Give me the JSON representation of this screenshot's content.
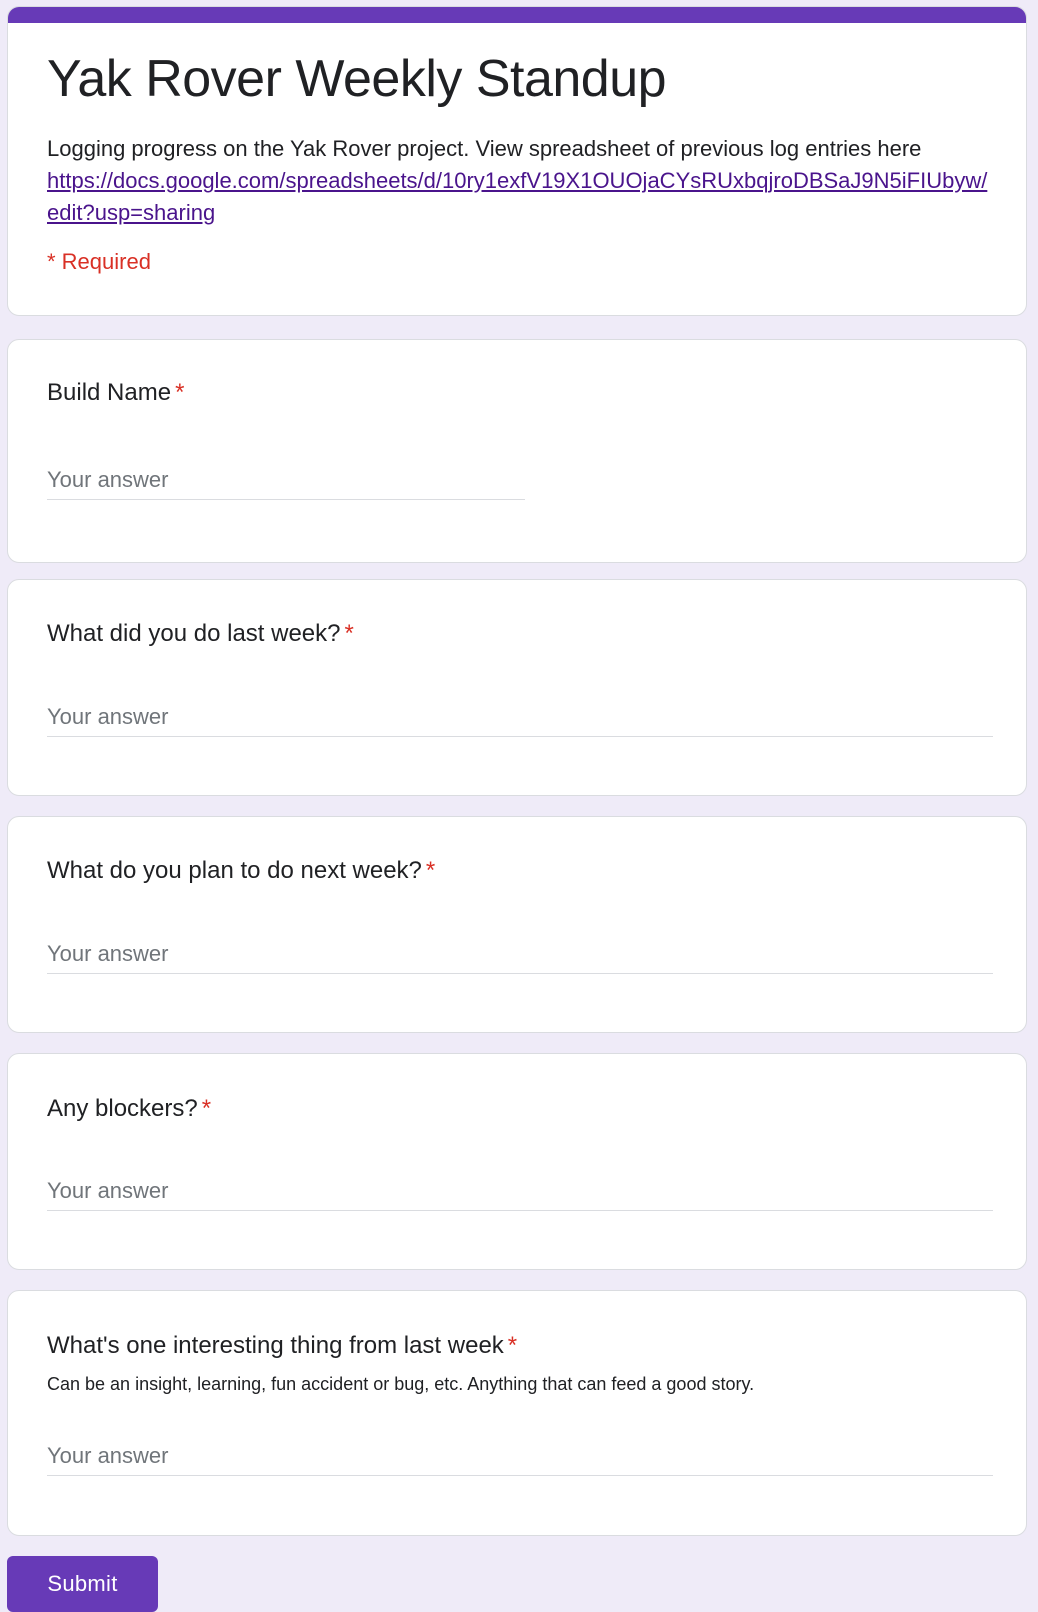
{
  "form": {
    "title": "Yak Rover Weekly Standup",
    "description": "Logging progress on the Yak Rover project. View spreadsheet of previous log entries here",
    "link": "https://docs.google.com/spreadsheets/d/10ry1exfV19X1OUOjaCYsRUxbqjroDBSaJ9N5iFIUbyw/edit?usp=sharing",
    "required_note": "* Required",
    "accent_color": "#673ab7",
    "background_color": "#efebf8",
    "required_color": "#d93025"
  },
  "questions": [
    {
      "title": "Build Name",
      "required_mark": "*",
      "placeholder": "Your answer",
      "value": ""
    },
    {
      "title": "What did you do last week?",
      "required_mark": "*",
      "placeholder": "Your answer",
      "value": ""
    },
    {
      "title": "What do you plan to do next week?",
      "required_mark": "*",
      "placeholder": "Your answer",
      "value": ""
    },
    {
      "title": "Any blockers?",
      "required_mark": "*",
      "placeholder": "Your answer",
      "value": ""
    },
    {
      "title": "What's one interesting thing from last week",
      "required_mark": "*",
      "help": "Can be an insight, learning, fun accident or bug, etc. Anything that can feed a good story.",
      "placeholder": "Your answer",
      "value": ""
    }
  ],
  "submit": {
    "label": "Submit"
  }
}
